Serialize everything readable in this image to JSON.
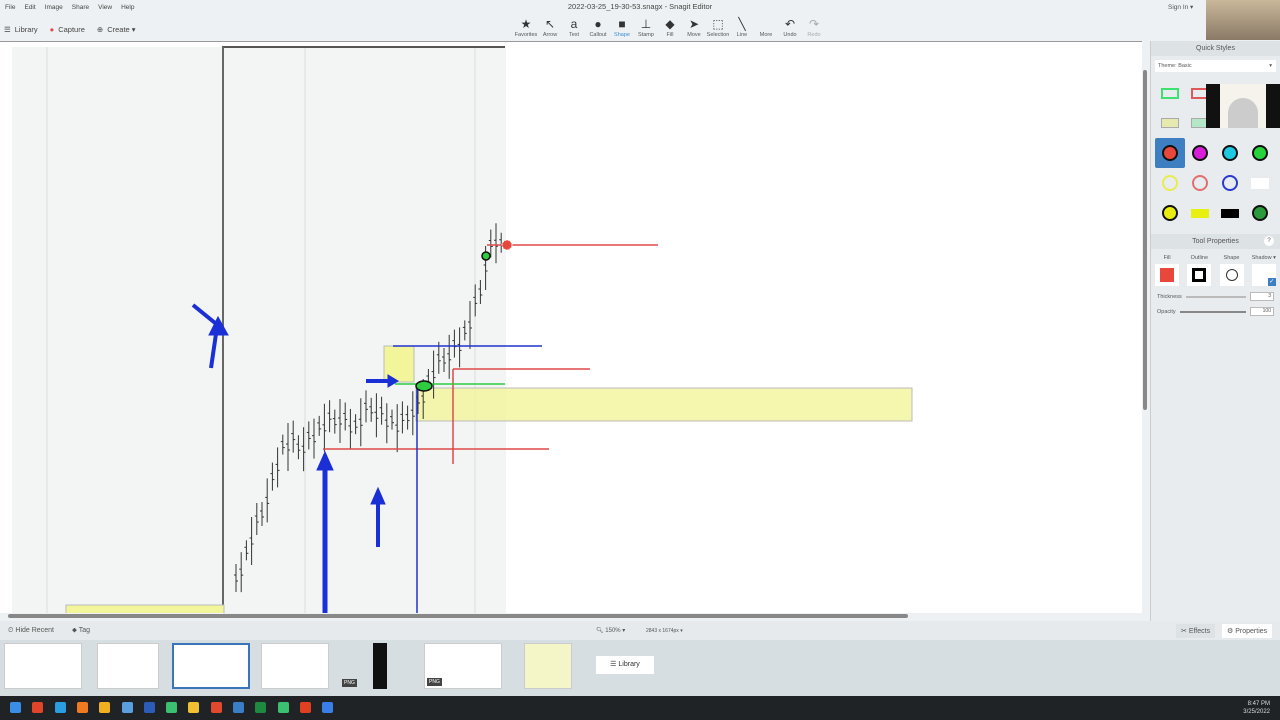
{
  "window": {
    "title": "2022-03-25_19-30-53.snagx - Snagit Editor",
    "sign_in": "Sign In ▾"
  },
  "menu": [
    "File",
    "Edit",
    "Image",
    "Share",
    "View",
    "Help"
  ],
  "left_toolbar": {
    "library": "Library",
    "capture": "Capture",
    "create": "Create ▾"
  },
  "tools": [
    {
      "label": "Favorites",
      "icon": "★"
    },
    {
      "label": "Arrow",
      "icon": "↖"
    },
    {
      "label": "Text",
      "icon": "a"
    },
    {
      "label": "Callout",
      "icon": "●"
    },
    {
      "label": "Shape",
      "icon": "■"
    },
    {
      "label": "Stamp",
      "icon": "⊥"
    },
    {
      "label": "Fill",
      "icon": "◆"
    },
    {
      "label": "Move",
      "icon": "➤"
    },
    {
      "label": "Selection",
      "icon": "⬚"
    },
    {
      "label": "Line",
      "icon": "╲"
    },
    {
      "label": "More",
      "icon": ""
    },
    {
      "label": "Undo",
      "icon": "↶"
    },
    {
      "label": "Redo",
      "icon": "↷"
    }
  ],
  "active_tool": "Shape",
  "panel": {
    "quick_styles": "Quick Styles",
    "theme_label": "Theme:",
    "theme_value": "Basic",
    "tool_properties": "Tool Properties",
    "help": "?",
    "fill": "Fill",
    "outline": "Outline",
    "shape": "Shape",
    "shadow": "Shadow ▾",
    "thickness_label": "Thickness",
    "thickness_value": "3",
    "opacity_label": "Opacity",
    "opacity_value": "100",
    "fill_color": "#e8473b"
  },
  "bottom": {
    "hide_recent": "Hide Recent",
    "tag": "Tag",
    "zoom": "150% ▾",
    "dimensions": "2843 x 1674px ▾",
    "effects": "Effects",
    "properties": "Properties"
  },
  "tray": {
    "png_badge": "PNG",
    "library": "Library"
  },
  "clock": {
    "time": "8:47 PM",
    "date": "3/25/2022"
  },
  "colors": {
    "blue_annot": "#1a2fd6",
    "red_line": "#e04848",
    "yellow_zone": "#f2f59a",
    "green": "#2ecc40"
  }
}
